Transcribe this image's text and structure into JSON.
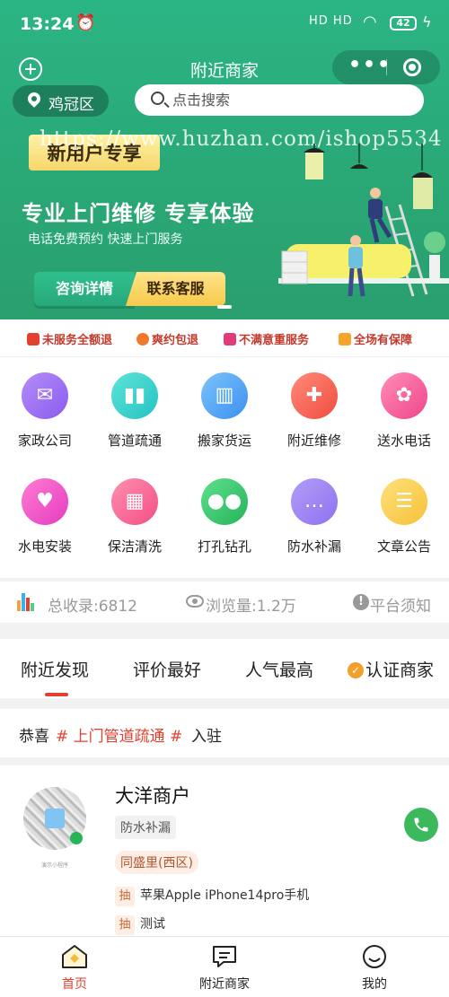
{
  "status_bar": {
    "time": "13:24",
    "network": "HD HD",
    "battery": "42"
  },
  "navbar": {
    "title": "附近商家"
  },
  "location": {
    "label": "鸡冠区"
  },
  "search": {
    "placeholder": "点击搜索"
  },
  "banner": {
    "watermark": "https://www.huzhan.com/ishop5534",
    "tag": "新用户专享",
    "title": "专业上门维修 专享体验",
    "subtitle": "电话免费预约 快速上门服务",
    "consult_label": "咨询详情",
    "service_label": "联系客服"
  },
  "guarantees": [
    {
      "label": "未服务全额退",
      "color": "#e3402f"
    },
    {
      "label": "爽约包退",
      "color": "#f07a2b"
    },
    {
      "label": "不满意重服务",
      "color": "#e23a7a"
    },
    {
      "label": "全场有保障",
      "color": "#f4a52a"
    }
  ],
  "categories": [
    {
      "label": "家政公司",
      "icon": "envelope-icon",
      "colors": [
        "#b58cf7",
        "#8a5cf0"
      ]
    },
    {
      "label": "管道疏通",
      "icon": "pipe-icon",
      "colors": [
        "#5fe3d9",
        "#22c4c2"
      ]
    },
    {
      "label": "搬家货运",
      "icon": "building-icon",
      "colors": [
        "#7cc4fb",
        "#3c8ff0"
      ]
    },
    {
      "label": "附近维修",
      "icon": "wrench-icon",
      "colors": [
        "#ff8b7a",
        "#f14c3f"
      ]
    },
    {
      "label": "送水电话",
      "icon": "film-reel-icon",
      "colors": [
        "#ff8db8",
        "#f0458a"
      ]
    },
    {
      "label": "水电安装",
      "icon": "heart-icon",
      "colors": [
        "#ff7cd2",
        "#e53cc0"
      ]
    },
    {
      "label": "保洁清洗",
      "icon": "calendar-icon",
      "colors": [
        "#ff8fb0",
        "#f34f84"
      ]
    },
    {
      "label": "打孔钻孔",
      "icon": "cherry-icon",
      "colors": [
        "#5fe08c",
        "#24b45a"
      ]
    },
    {
      "label": "防水补漏",
      "icon": "chat-icon",
      "colors": [
        "#b39cf8",
        "#8e72ef"
      ]
    },
    {
      "label": "文章公告",
      "icon": "clipboard-icon",
      "colors": [
        "#ffe07a",
        "#f6c23a"
      ]
    }
  ],
  "stats": {
    "total": "总收录:6812",
    "views": "浏览量:1.2万",
    "notice": "平台须知"
  },
  "tabs": [
    "附近发现",
    "评价最好",
    "人气最高",
    "认证商家"
  ],
  "announcement": {
    "prefix": "恭喜",
    "highlight": "# 上门管道疏通 #",
    "suffix": "入驻"
  },
  "merchant": {
    "name": "大洋商户",
    "category": "防水补漏",
    "area": "同盛里(西区)",
    "qr_caption": "演示小程序",
    "lottery_tag": "抽",
    "items": [
      "苹果Apple iPhone14pro手机",
      "测试"
    ]
  },
  "tabbar": [
    {
      "label": "首页",
      "icon": "home-icon"
    },
    {
      "label": "附近商家",
      "icon": "message-icon"
    },
    {
      "label": "我的",
      "icon": "smiley-icon"
    }
  ],
  "accent_color": "#2bb584",
  "highlight_color": "#e3402f"
}
